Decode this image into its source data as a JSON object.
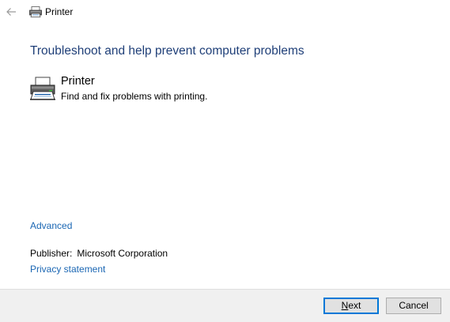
{
  "window": {
    "title": "Printer"
  },
  "main": {
    "heading": "Troubleshoot and help prevent computer problems",
    "item": {
      "title": "Printer",
      "description": "Find and fix problems with printing."
    },
    "advanced_link": "Advanced",
    "publisher_label": "Publisher:",
    "publisher_value": "Microsoft Corporation",
    "privacy_link": "Privacy statement"
  },
  "footer": {
    "next_accel": "N",
    "next_rest": "ext",
    "cancel_label": "Cancel"
  },
  "colors": {
    "heading": "#1f3f78",
    "link": "#1a66b3",
    "default_button_border": "#0078d7",
    "footer_bg": "#f0f0f0"
  },
  "icons": {
    "back": "back-arrow-icon",
    "title": "printer-icon",
    "item": "printer-icon"
  }
}
